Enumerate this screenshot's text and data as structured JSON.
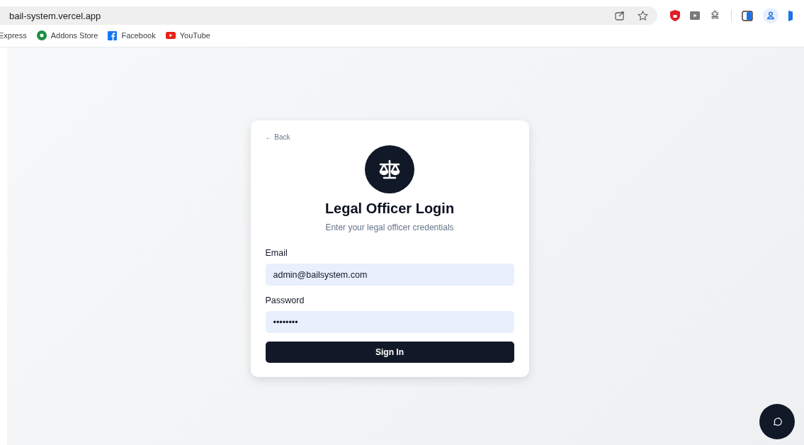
{
  "browser": {
    "address": "bail-system.vercel.app",
    "bookmarks": [
      {
        "label": "Express",
        "kind": "cut"
      },
      {
        "label": "Addons Store",
        "kind": "addons"
      },
      {
        "label": "Facebook",
        "kind": "facebook"
      },
      {
        "label": "YouTube",
        "kind": "youtube"
      }
    ]
  },
  "card": {
    "back": "← Back",
    "title": "Legal Officer Login",
    "subtitle": "Enter your legal officer credentials",
    "fields": [
      {
        "label": "Email",
        "value": "admin@bailsystem.com"
      },
      {
        "label": "Password",
        "value": "••••••••"
      }
    ],
    "button": "Sign In"
  }
}
